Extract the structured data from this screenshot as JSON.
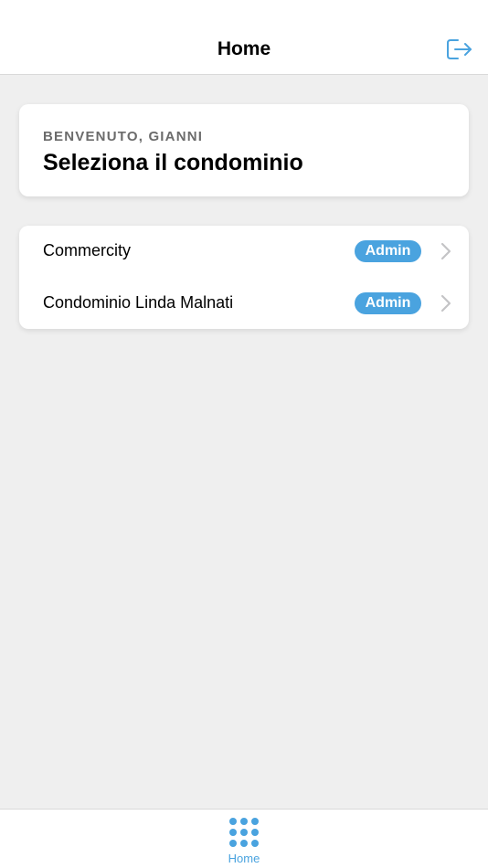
{
  "header": {
    "title": "Home",
    "logout_icon": "logout-icon"
  },
  "welcome": {
    "subtitle": "BENVENUTO, GIANNI",
    "title": "Seleziona il condominio"
  },
  "condominiums": [
    {
      "name": "Commercity",
      "role": "Admin"
    },
    {
      "name": "Condominio Linda Malnati",
      "role": "Admin"
    }
  ],
  "tabbar": {
    "items": [
      {
        "label": "Home",
        "icon": "grid-dots-icon",
        "active": true
      }
    ]
  },
  "colors": {
    "accent": "#4aa3df",
    "background": "#efefef",
    "card": "#ffffff"
  }
}
